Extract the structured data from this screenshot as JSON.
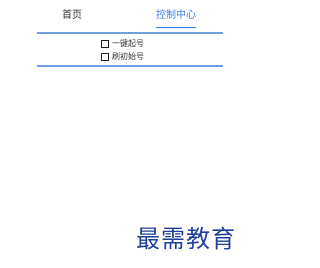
{
  "tabs": [
    {
      "label": "首页"
    },
    {
      "label": "控制中心"
    }
  ],
  "options": [
    {
      "label": "一键起号",
      "checked": false
    },
    {
      "label": "刷初始号",
      "checked": false
    }
  ],
  "watermark": "最需教育",
  "colors": {
    "accent": "#3d7ed8",
    "rule": "#6f9ee3",
    "watermark": "#1f3f9c"
  }
}
